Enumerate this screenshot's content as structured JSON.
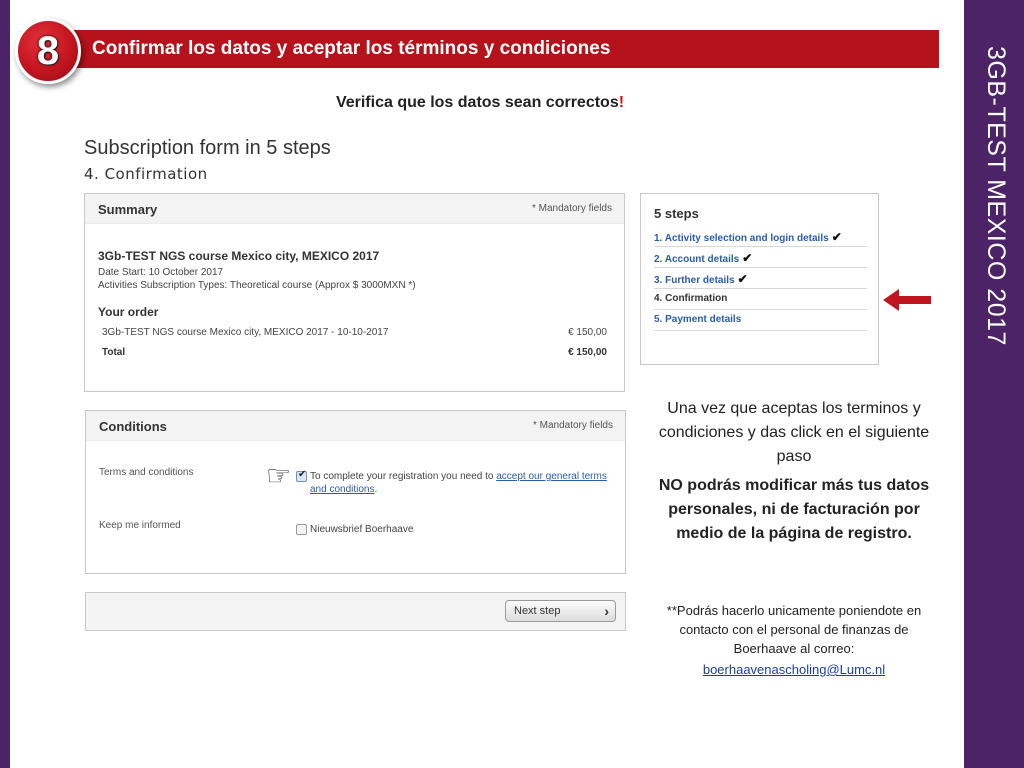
{
  "slide": {
    "step_number": "8",
    "header_title": "Confirmar los datos y aceptar los términos y condiciones",
    "side_title": "3GB-TEST MEXICO 2017",
    "subtitle": "Verifica que los datos sean correctos",
    "subtitle_mark": "!"
  },
  "form": {
    "title": "Subscription form in 5 steps",
    "subtitle": "4. Confirmation",
    "mandatory_label": "* Mandatory fields"
  },
  "summary": {
    "heading": "Summary",
    "course_title": "3Gb-TEST NGS course Mexico city, MEXICO 2017",
    "date_start": "Date Start: 10 October 2017",
    "activities": "Activities Subscription Types: Theoretical course (Approx $ 3000MXN *)",
    "order_heading": "Your order",
    "order_items": [
      {
        "label": "3Gb-TEST NGS course Mexico city, MEXICO 2017 - 10-10-2017",
        "price": "€ 150,00"
      }
    ],
    "total_label": "Total",
    "total_price": "€ 150,00"
  },
  "steps": {
    "heading": "5 steps",
    "items": [
      {
        "label": "1. Activity selection and login details",
        "check": "✔"
      },
      {
        "label": "2. Account details",
        "check": "✔"
      },
      {
        "label": "3. Further details",
        "check": "✔"
      },
      {
        "label": "4. Confirmation",
        "check": ""
      },
      {
        "label": "5. Payment details",
        "check": ""
      }
    ]
  },
  "conditions": {
    "heading": "Conditions",
    "terms_label": "Terms and conditions",
    "terms_text": "To complete your registration you need to",
    "terms_link": "accept our general terms and conditions",
    "terms_end": ".",
    "keep_label": "Keep me informed",
    "newsletter_label": "Nieuwsbrief Boerhaave",
    "terms_checked": true,
    "newsletter_checked": false
  },
  "actions": {
    "next_label": "Next step",
    "next_chevron": "›"
  },
  "info": {
    "line1": "Una vez que aceptas los terminos y condiciones y das click en el siguiente paso",
    "warning": "NO podrás modificar más tus datos  personales, ni de facturación por medio de la página de registro.",
    "note": "**Podrás hacerlo unicamente poniendote en contacto con el personal de finanzas de Boerhaave al correo:",
    "email": "boerhaavenascholing@Lumc.nl"
  },
  "colors": {
    "purple_bar": "#4b2366",
    "header_red": "#b5121b",
    "link_blue": "#2a5caa",
    "arrow_red": "#c0151e"
  },
  "icons": {
    "pointer": "pointing-hand-icon",
    "arrow": "left-arrow-icon",
    "check": "check-icon",
    "chevron": "chevron-right-icon"
  }
}
